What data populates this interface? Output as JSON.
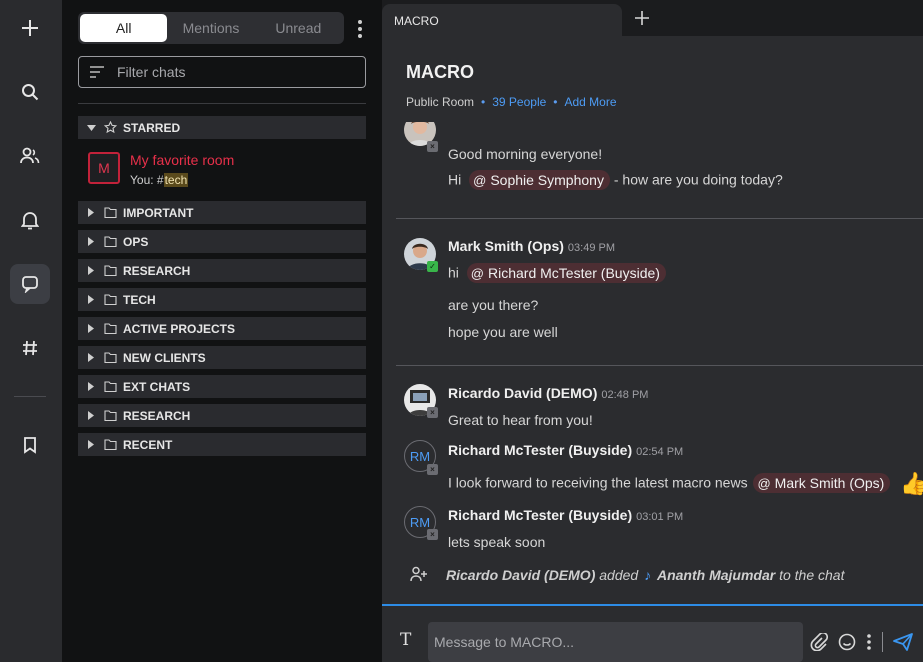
{
  "rail": {
    "items": [
      {
        "name": "new-chat",
        "icon": "plus-icon"
      },
      {
        "name": "search",
        "icon": "search-icon"
      },
      {
        "name": "contacts",
        "icon": "people-icon"
      },
      {
        "name": "notifications",
        "icon": "bell-icon"
      },
      {
        "name": "chats",
        "icon": "chat-icon",
        "active": true
      },
      {
        "name": "channels",
        "icon": "hash-icon"
      },
      {
        "name": "saved",
        "icon": "bookmark-icon"
      }
    ]
  },
  "sidebar": {
    "tabs": [
      "All",
      "Mentions",
      "Unread"
    ],
    "active_tab": "All",
    "filter_placeholder": "Filter chats",
    "starred_label": "STARRED",
    "favorite_room": {
      "avatar": "M",
      "name": "My favorite room",
      "preview_prefix": "You: #",
      "preview_tag": "tech"
    },
    "folders": [
      "IMPORTANT",
      "OPS",
      "RESEARCH",
      "TECH",
      "ACTIVE PROJECTS",
      "NEW CLIENTS",
      "EXT CHATS",
      "RESEARCH",
      "RECENT"
    ]
  },
  "tabbar": {
    "tab_label": "MACRO"
  },
  "room": {
    "title": "MACRO",
    "type": "Public Room",
    "people": "39 People",
    "add_more": "Add More"
  },
  "messages": {
    "group1": {
      "line1": "Good morning everyone!",
      "line2_prefix": "Hi",
      "line2_mention": "Sophie Symphony",
      "line2_suffix": "- how are you doing today?"
    },
    "group2": {
      "author": "Mark Smith (Ops)",
      "time": "03:49 PM",
      "line1_prefix": "hi",
      "line1_mention": "Richard McTester (Buyside)",
      "line2": "are you there?",
      "line3": "hope you are well"
    },
    "group3": {
      "author": "Ricardo David (DEMO)",
      "time": "02:48 PM",
      "line1": "Great to hear from you!"
    },
    "group4": {
      "avatar": "RM",
      "author": "Richard McTester (Buyside)",
      "time": "02:54 PM",
      "line1": "I look forward to receiving the latest macro news",
      "mention": "Mark Smith (Ops)",
      "reaction": "👍"
    },
    "group5": {
      "avatar": "RM",
      "author": "Richard McTester (Buyside)",
      "time": "03:01 PM",
      "line1": "lets speak soon"
    },
    "system": {
      "actor": "Ricardo David (DEMO)",
      "verb": "added",
      "target": "Ananth Majumdar",
      "suffix": "to the chat"
    }
  },
  "composer": {
    "placeholder": "Message to MACRO...",
    "format_icon": "T"
  },
  "colors": {
    "accent": "#2d8ce6",
    "mention_bg": "#4d2e33",
    "favorite": "#e8304a",
    "link": "#4d9cf5"
  }
}
